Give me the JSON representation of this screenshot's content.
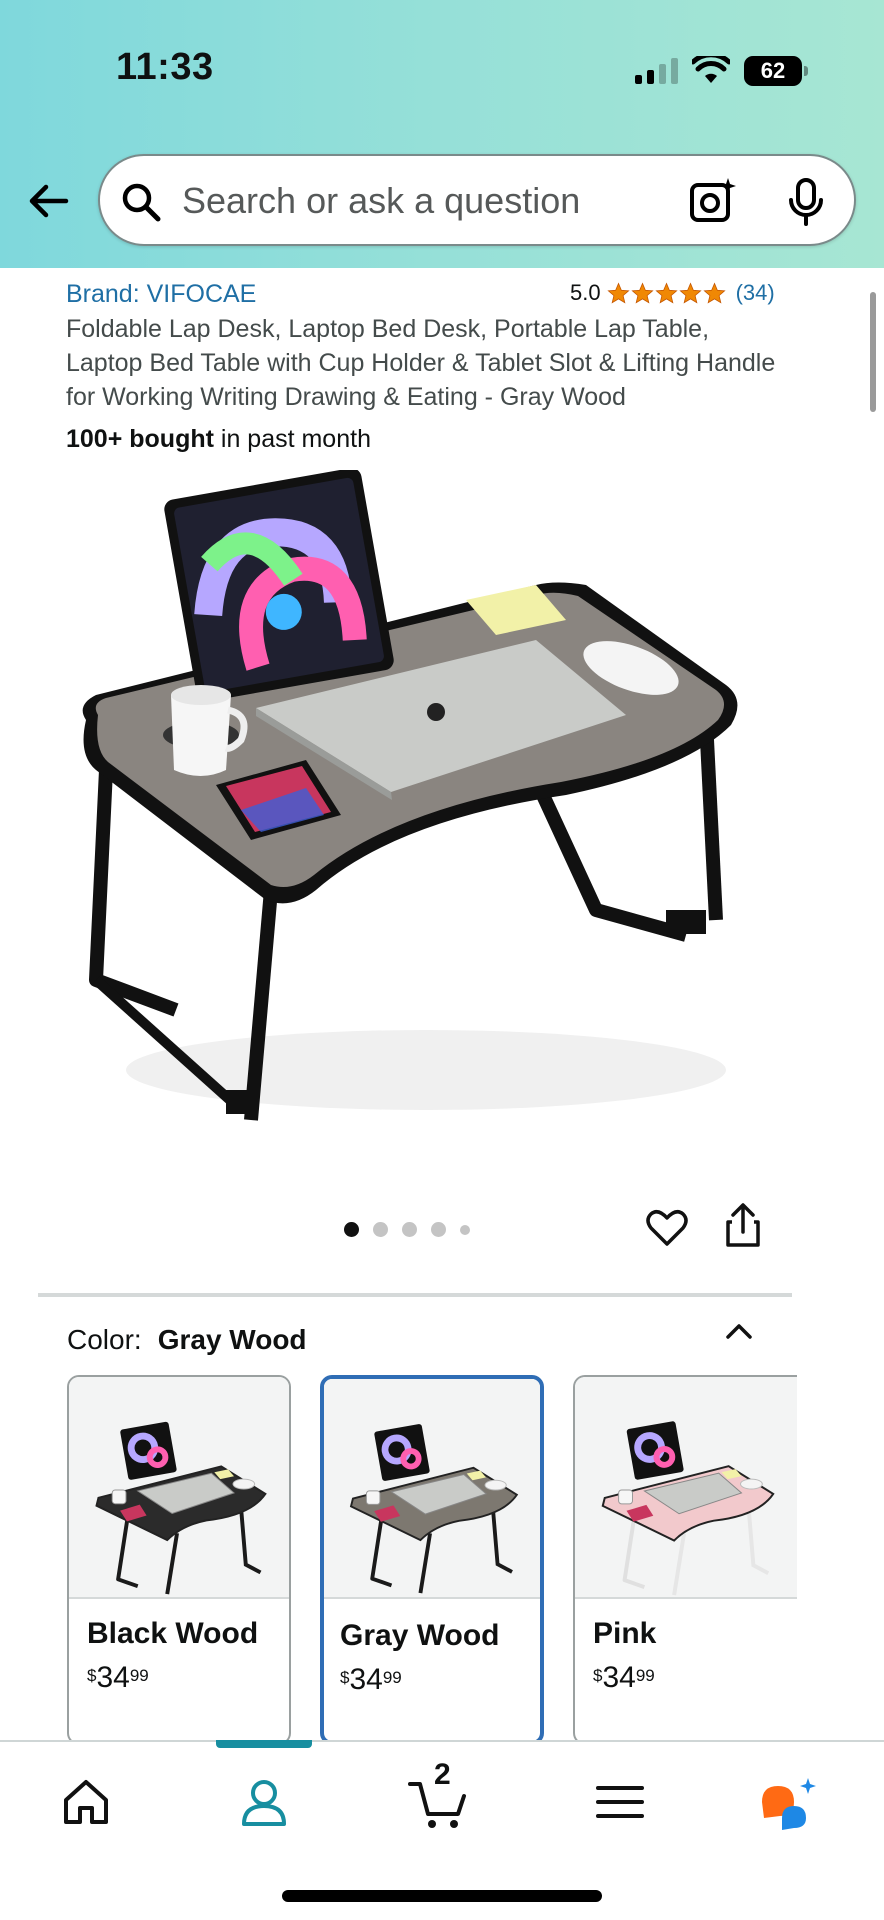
{
  "status_bar": {
    "time": "11:33",
    "battery": "62"
  },
  "search": {
    "placeholder": "Search or ask a question"
  },
  "product": {
    "brand": "Brand: VIFOCAE",
    "rating_value": "5.0",
    "rating_count": "(34)",
    "stars": 5,
    "title": "Foldable Lap Desk, Laptop Bed Desk, Portable Lap Table, Laptop Bed Table with Cup Holder & Tablet Slot & Lifting Handle for Working Writing Drawing & Eating - Gray Wood",
    "bought_bold": "100+ bought",
    "bought_rest": " in past month"
  },
  "gallery": {
    "image_count": 5,
    "active_index": 0
  },
  "color": {
    "label": "Color:",
    "selected": "Gray Wood",
    "options": [
      {
        "name": "Black Wood",
        "currency": "$",
        "whole": "34",
        "fraction": "99",
        "top_color": "#2b2b2b",
        "leg_color": "#1a1a1a"
      },
      {
        "name": "Gray Wood",
        "currency": "$",
        "whole": "34",
        "fraction": "99",
        "top_color": "#7d7870",
        "leg_color": "#1a1a1a"
      },
      {
        "name": "Pink",
        "currency": "$",
        "whole": "34",
        "fraction": "99",
        "top_color": "#f2c9cc",
        "leg_color": "#f4f4f4"
      }
    ]
  },
  "nav": {
    "cart_count": "2"
  },
  "colors": {
    "link": "#1f6fa5",
    "star": "#f08804",
    "accent": "#178ea0",
    "selected_border": "#2f6db5"
  }
}
